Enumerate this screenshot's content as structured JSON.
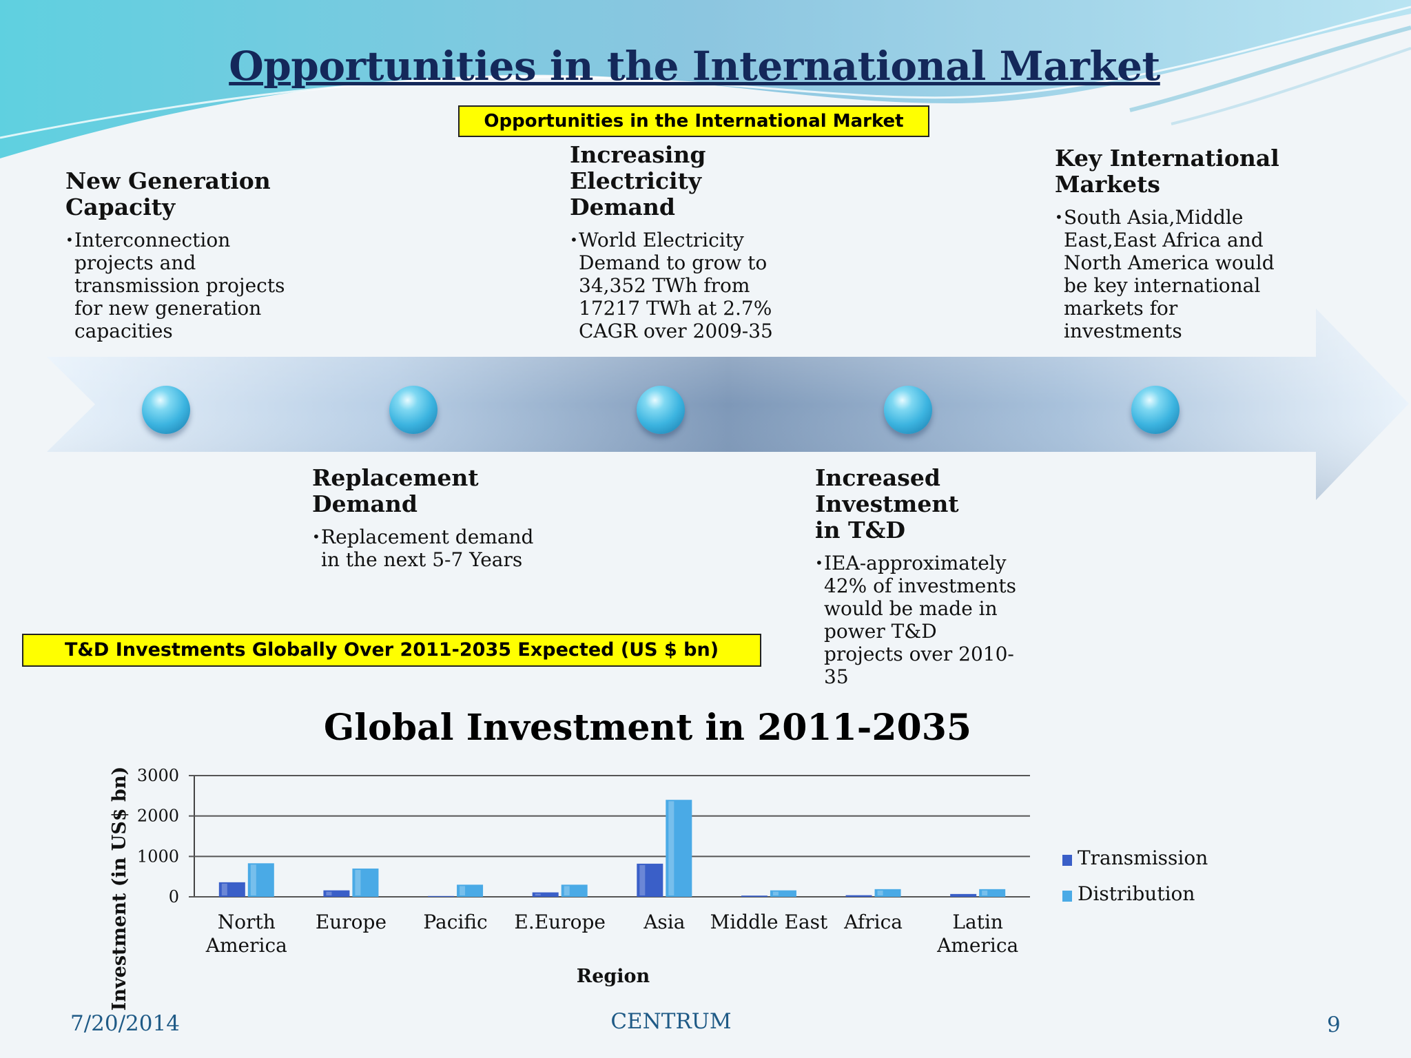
{
  "slide": {
    "title": "Opportunities in the International Market",
    "top_box": "Opportunities in the International Market",
    "bottom_box": "T&D Investments Globally Over 2011-2035 Expected (US $ bn)"
  },
  "timeline": {
    "new_generation": {
      "heading": "New Generation Capacity",
      "bullet": "Interconnection projects and transmission projects for new generation capacities"
    },
    "increasing_demand": {
      "heading": "Increasing Electricity Demand",
      "bullet": "World Electricity Demand to grow to 34,352 TWh from 17217 TWh at 2.7% CAGR over 2009-35"
    },
    "key_markets": {
      "heading": "Key International Markets",
      "bullet": "South Asia,Middle East,East Africa and North America would be key international markets for investments"
    },
    "replacement": {
      "heading": "Replacement Demand",
      "bullet": "Replacement demand in the next 5-7 Years"
    },
    "td_investment": {
      "heading": "Increased Investment in T&D",
      "bullet": "IEA-approximately 42% of investments would be made in power T&D projects over 2010-35"
    }
  },
  "chart_data": {
    "type": "bar",
    "title": "Global Investment in 2011-2035",
    "xlabel": "Region",
    "ylabel": "Investment (in US$ bn)",
    "ylim": [
      0,
      3000
    ],
    "yticks": [
      "0",
      "1000",
      "2000",
      "3000"
    ],
    "categories": [
      [
        "North",
        "America"
      ],
      [
        "Europe"
      ],
      [
        "Pacific"
      ],
      [
        "E.Europe"
      ],
      [
        "Asia"
      ],
      [
        "Middle East"
      ],
      [
        "Africa"
      ],
      [
        "Latin",
        "America"
      ]
    ],
    "series": [
      {
        "name": "Transmission",
        "color": "#3a5fc8",
        "values": [
          360,
          160,
          20,
          110,
          820,
          30,
          40,
          70
        ]
      },
      {
        "name": "Distribution",
        "color": "#4aaae6",
        "values": [
          830,
          700,
          300,
          300,
          2400,
          160,
          190,
          190
        ]
      }
    ],
    "legend_position": "right",
    "grid": true
  },
  "footer": {
    "date": "7/20/2014",
    "center": "CENTRUM",
    "page": "9"
  }
}
